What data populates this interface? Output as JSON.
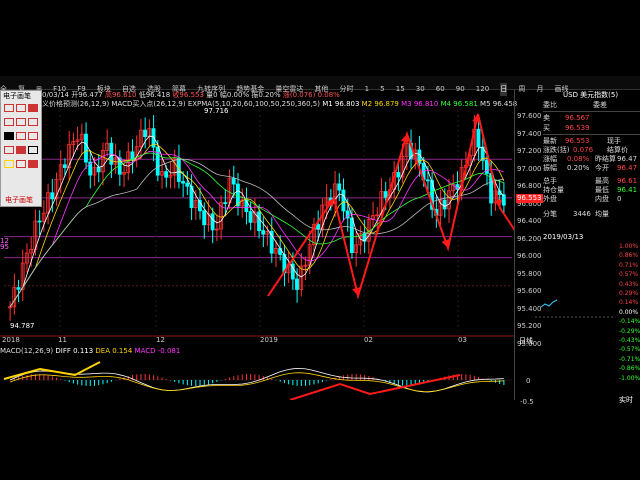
{
  "toolbar": {
    "items": [
      "全",
      "复",
      "⊞",
      "F10",
      "F9",
      "板块",
      "自选",
      "选股",
      "简幕",
      "九转序列",
      "趋势基金",
      "量空雷达",
      "其他",
      "分时",
      "1",
      "5",
      "15",
      "30",
      "60",
      "90",
      "120",
      "日",
      "周",
      "月",
      "画线"
    ]
  },
  "chart_header": {
    "date": "0/03/14",
    "open": "开96.477",
    "high": "高96.610",
    "low": "低96.418",
    "close": "收96.553",
    "amount": "量0",
    "change_pct": "幅0.00%",
    "amplitude": "振0.20%",
    "change": "涨(0.076)",
    "change_pct2": "0.08%"
  },
  "indicator_line": {
    "signal": "义价格预测(26,12,9)",
    "macd_buy": "MACD买入点(26,12,9)",
    "expma": "EXPMA(5,10,20,60,100,50,250,360,5)",
    "m1": "M1 96.803",
    "m2": "M2 96.879",
    "m3": "M3 96.810",
    "m4": "M4 96.581",
    "m5": "M5 96.458"
  },
  "chart_labels": {
    "peak": "97.716",
    "trough": "94.787",
    "months": [
      "2018",
      "11",
      "12",
      "2019",
      "02",
      "03"
    ],
    "price_axis": [
      "97.600",
      "97.400",
      "97.200",
      "97.000",
      "96.800",
      "96.600",
      "96.400",
      "96.200",
      "96.000",
      "95.800",
      "95.600",
      "95.400",
      "95.200",
      "95.000"
    ],
    "current_price": "96.553",
    "left_tags": [
      "12",
      "95"
    ]
  },
  "macd_panel": {
    "title": "MACD(12,26,9)",
    "diff": "DIFF 0.113",
    "dea": "DEA 0.154",
    "macd": "MACD -0.081",
    "axis": [
      "0",
      "-0.5"
    ]
  },
  "right_panel": {
    "title": "USD 美元指数(5)",
    "header_left": "委比",
    "header_right": "委差",
    "sell": "卖",
    "sell_val": "96.567",
    "buy": "买",
    "buy_val": "96.539",
    "latest": "最新",
    "latest_val": "96.553",
    "now_vol": "现手",
    "change_label": "涨跌(括)",
    "change_val": "0.076",
    "settle": "结算价",
    "change_pct_label": "涨幅",
    "change_pct_val": "0.08%",
    "prev_settle": "昨结算",
    "prev_settle_val": "96.47",
    "amplitude_label": "振幅",
    "amplitude_val": "0.20%",
    "open": "今开",
    "open_val": "96.47",
    "total_vol": "总手",
    "high": "最高",
    "high_val": "96.61",
    "open_int": "持仓量",
    "low": "最低",
    "low_val": "96.41",
    "outer": "外盘",
    "inner": "内盘",
    "inner_val": "0",
    "split": "分笔",
    "split_val": "3446",
    "avg": "均量",
    "date": "2019/03/13",
    "day_line": "日线",
    "intraday_axis": [
      "1.00%",
      "0.86%",
      "0.71%",
      "0.57%",
      "0.43%",
      "0.29%",
      "0.14%",
      "0.00%",
      "-0.14%",
      "-0.29%",
      "-0.43%",
      "-0.57%",
      "-0.71%",
      "-0.86%",
      "-1.00%"
    ],
    "bottom_tab": "实时"
  },
  "palette": {
    "title": "电子画笔",
    "footer": "电子画笔"
  },
  "colors": {
    "bg": "#000000",
    "up": "#ff3232",
    "down": "#00ffff",
    "arrow": "#ff1a1a",
    "yellow": "#ffd400",
    "magenta": "#ff33ff",
    "green": "#33ff33"
  },
  "chart_data": {
    "type": "line",
    "title": "",
    "xlabel": "",
    "ylabel": "",
    "ylim": [
      94.6,
      97.8
    ],
    "series": [
      {
        "values": [
          95.0,
          95.6,
          96.2,
          96.6,
          97.1,
          97.5,
          96.8,
          97.3,
          96.9,
          97.2,
          97.6,
          96.8,
          97.0,
          96.6,
          96.3,
          96.1,
          96.8,
          96.4,
          96.2,
          95.9,
          95.6,
          95.3,
          96.0,
          96.5,
          96.7,
          95.8,
          96.1,
          96.5,
          96.8,
          97.3,
          97.0,
          96.3,
          96.6,
          96.9,
          97.5,
          96.6,
          96.553
        ]
      }
    ]
  }
}
